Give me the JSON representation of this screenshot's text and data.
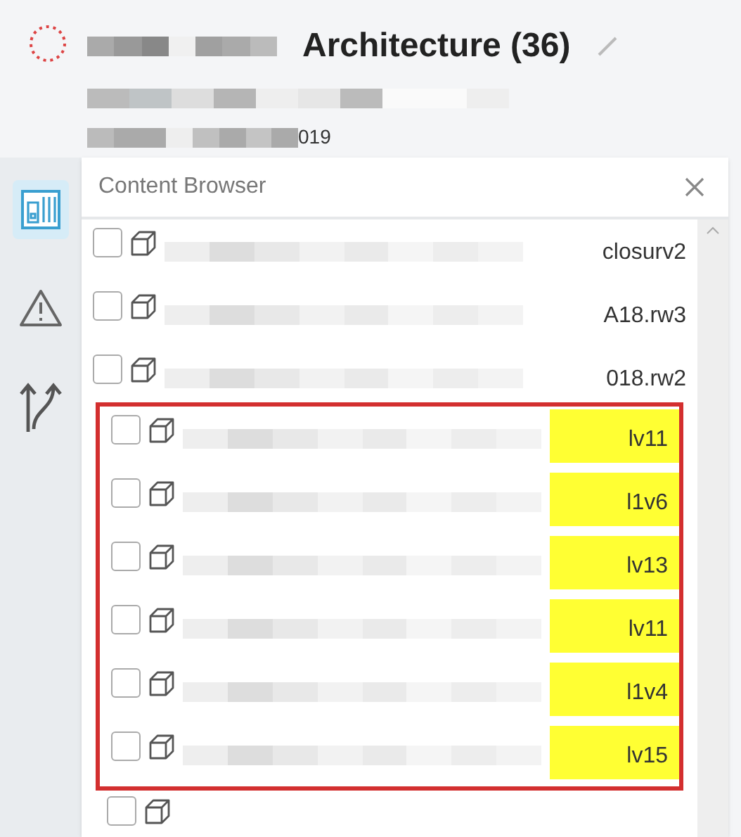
{
  "header": {
    "title": "Architecture (36)",
    "date_fragment": "019"
  },
  "rail": [
    {
      "kind": "sheets",
      "selected": true
    },
    {
      "kind": "warning",
      "selected": false
    },
    {
      "kind": "merge",
      "selected": false
    }
  ],
  "panel": {
    "title": "Content Browser"
  },
  "items": [
    {
      "label": "closurv2",
      "checked": false,
      "highlighted": false
    },
    {
      "label": "A18.rw3",
      "checked": false,
      "highlighted": false
    },
    {
      "label": "018.rw2",
      "checked": false,
      "highlighted": false
    }
  ],
  "flagged_items": [
    {
      "label": "lv11",
      "checked": false,
      "highlighted": true
    },
    {
      "label": "l1v6",
      "checked": false,
      "highlighted": true
    },
    {
      "label": "lv13",
      "checked": false,
      "highlighted": true
    },
    {
      "label": "lv11",
      "checked": false,
      "highlighted": true
    },
    {
      "label": "l1v4",
      "checked": false,
      "highlighted": true
    },
    {
      "label": "lv15",
      "checked": false,
      "highlighted": true
    }
  ],
  "items_after": [
    {
      "checked": false
    }
  ]
}
